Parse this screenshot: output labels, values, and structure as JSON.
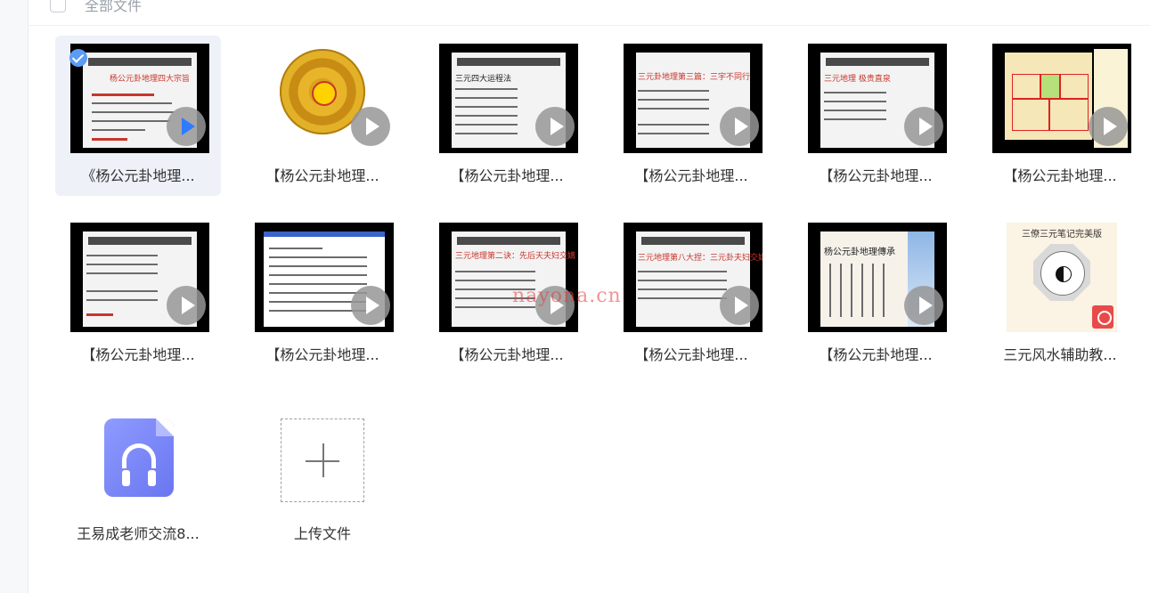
{
  "header": {
    "title": "全部文件"
  },
  "items": [
    {
      "name": "《杨公元卦地理...",
      "type": "video",
      "selected": true,
      "thumb_title": "杨公元卦地理四大宗旨"
    },
    {
      "name": "【杨公元卦地理...",
      "type": "video",
      "selected": false
    },
    {
      "name": "【杨公元卦地理...",
      "type": "video",
      "selected": false,
      "thumb_title": "三元四大运程法"
    },
    {
      "name": "【杨公元卦地理...",
      "type": "video",
      "selected": false,
      "thumb_title": "三元卦地理第三篇：三宇不同行"
    },
    {
      "name": "【杨公元卦地理...",
      "type": "video",
      "selected": false,
      "thumb_title": "三元地理 极贵直泉"
    },
    {
      "name": "【杨公元卦地理...",
      "type": "video",
      "selected": false
    },
    {
      "name": "【杨公元卦地理...",
      "type": "video",
      "selected": false
    },
    {
      "name": "【杨公元卦地理...",
      "type": "video",
      "selected": false
    },
    {
      "name": "【杨公元卦地理...",
      "type": "video",
      "selected": false,
      "thumb_title": "三元地理第二诀：先后天夫妇交媾"
    },
    {
      "name": "【杨公元卦地理...",
      "type": "video",
      "selected": false,
      "thumb_title": "三元地理第八大捏：三元卦夫妇交媾"
    },
    {
      "name": "【杨公元卦地理...",
      "type": "video",
      "selected": false,
      "thumb_title": "杨公元卦地理傳承"
    },
    {
      "name": "三元风水辅助教...",
      "type": "pdf",
      "selected": false,
      "thumb_title": "三僚三元笔记完美版"
    },
    {
      "name": "王易成老师交流8...",
      "type": "audio",
      "selected": false
    }
  ],
  "upload": {
    "label": "上传文件"
  },
  "watermark": "nayona.cn"
}
